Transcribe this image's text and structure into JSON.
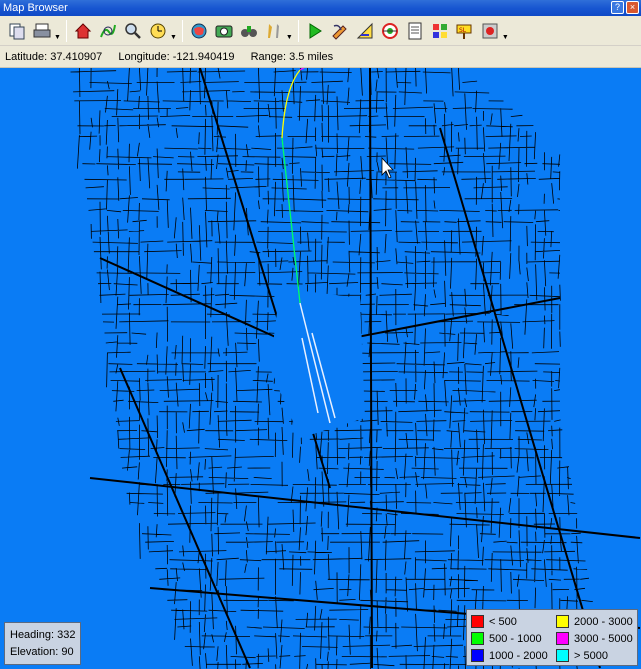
{
  "window": {
    "title": "Map Browser",
    "help": "?",
    "close": "×"
  },
  "toolbar": {
    "tools": [
      {
        "name": "copy-pages-icon",
        "drop": false
      },
      {
        "name": "print-icon",
        "drop": true
      },
      {
        "sep": true
      },
      {
        "name": "home-icon",
        "drop": false
      },
      {
        "name": "route-icon",
        "drop": false
      },
      {
        "name": "magnifier-icon",
        "drop": false
      },
      {
        "name": "clock-icon",
        "drop": true
      },
      {
        "sep": true
      },
      {
        "name": "globe-icon",
        "drop": false
      },
      {
        "name": "camera-icon",
        "drop": false
      },
      {
        "name": "binoculars-icon",
        "drop": false
      },
      {
        "name": "tools-icon",
        "drop": true
      },
      {
        "sep": true
      },
      {
        "name": "play-icon",
        "drop": false
      },
      {
        "name": "pencil-path-icon",
        "drop": false
      },
      {
        "name": "ruler-icon",
        "drop": false
      },
      {
        "name": "target-icon",
        "drop": false
      },
      {
        "name": "notepad-icon",
        "drop": false
      },
      {
        "name": "grid-palette-icon",
        "drop": false
      },
      {
        "name": "sign-icon",
        "drop": false
      },
      {
        "name": "record-icon",
        "drop": true
      }
    ]
  },
  "status": {
    "latitude": "Latitude: 37.410907",
    "longitude": "Longitude: -121.940419",
    "range": "Range: 3.5 miles"
  },
  "info": {
    "heading": "Heading: 332",
    "elevation": "Elevation: 90"
  },
  "legend": {
    "items": [
      {
        "label": "< 500",
        "color": "#ff0000"
      },
      {
        "label": "2000 - 3000",
        "color": "#ffff00"
      },
      {
        "label": "500 - 1000",
        "color": "#00ff00"
      },
      {
        "label": "3000 - 5000",
        "color": "#ff00ff"
      },
      {
        "label": "1000 - 2000",
        "color": "#0000ff"
      },
      {
        "label": "> 5000",
        "color": "#00ffff"
      }
    ]
  },
  "colors": {
    "water": "#0a7cf5",
    "roads": "#000000"
  }
}
